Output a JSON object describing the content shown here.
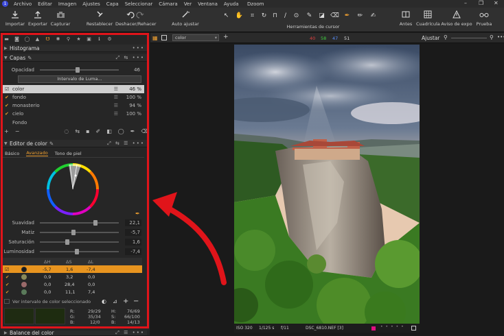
{
  "menu": {
    "items": [
      "Archivo",
      "Editar",
      "Imagen",
      "Ajustes",
      "Capa",
      "Seleccionar",
      "Cámara",
      "Ver",
      "Ventana",
      "Ayuda"
    ],
    "title": "Dzoom",
    "window_controls": [
      "–",
      "❐",
      "✕"
    ]
  },
  "toolbar": {
    "importar": "Importar",
    "exportar": "Exportar",
    "capturar": "Capturar",
    "restablecer": "Restablecer",
    "deshacer": "Deshacer/Rehacer",
    "auto": "Auto ajustar",
    "cursor_tools": "Herramientas de cursor",
    "antes": "Antes",
    "cuadricula": "Cuadrícula",
    "aviso": "Aviso de expo",
    "prueba": "Prueba"
  },
  "viewer_bar": {
    "select_value": "color",
    "values": [
      "40",
      "58",
      "47",
      "51"
    ],
    "ajustar": "Ajustar"
  },
  "panels": {
    "histograma": "Histograma",
    "capas": "Capas",
    "opacidad_label": "Opacidad",
    "opacidad_value": "46",
    "intervalo_luma": "Intervalo de Luma...",
    "layers": [
      {
        "name": "color",
        "pct": "46 %"
      },
      {
        "name": "fondo",
        "pct": "100 %"
      },
      {
        "name": "monasterio",
        "pct": "94 %"
      },
      {
        "name": "cielo",
        "pct": "100 %"
      }
    ],
    "fondo_label": "Fondo",
    "editor_color": "Editor de color",
    "subtabs": [
      "Básico",
      "Avanzado",
      "Tono de piel"
    ],
    "sliders": [
      {
        "name": "Suavidad",
        "value": "22,1",
        "level": 0.72
      },
      {
        "name": "Matiz",
        "value": "-5,7",
        "level": 0.42
      },
      {
        "name": "Saturación",
        "value": "1,6",
        "level": 0.34
      },
      {
        "name": "Luminosidad",
        "value": "-7,4",
        "level": 0.47
      }
    ],
    "table_headers": [
      "ΔH",
      "ΔS",
      "ΔL"
    ],
    "color_rows": [
      {
        "h": "-5,7",
        "s": "1,6",
        "l": "-7,4",
        "color": "#1a1a1a",
        "selected": true
      },
      {
        "h": "0,9",
        "s": "3,2",
        "l": "0,0",
        "color": "#8a8a5a",
        "selected": false
      },
      {
        "h": "0,0",
        "s": "28,4",
        "l": "0,0",
        "color": "#9a6a6a",
        "selected": false
      },
      {
        "h": "0,0",
        "s": "11,1",
        "l": "7,4",
        "color": "#5a7a5a",
        "selected": false
      }
    ],
    "ver_intervalo": "Ver intervalo de color seleccionado",
    "readout": {
      "r_label": "R:",
      "r_val": "29/29",
      "g_label": "G:",
      "g_val": "35/34",
      "b_label": "B:",
      "b_val": "12/0",
      "h_label": "H:",
      "h_val": "76/69",
      "s_label": "S:",
      "s_val": "66/100",
      "bb_label": "B:",
      "bb_val": "14/13"
    },
    "balance": "Balance del color"
  },
  "photo_bar": {
    "iso": "ISO 320",
    "speed": "1/125 s",
    "aperture": "f/11",
    "file": "DSC_6810.NEF [3]"
  },
  "colors": {
    "accent": "#f0a030",
    "annotation_red": "#e0141a",
    "selected_row": "#e8941f"
  }
}
